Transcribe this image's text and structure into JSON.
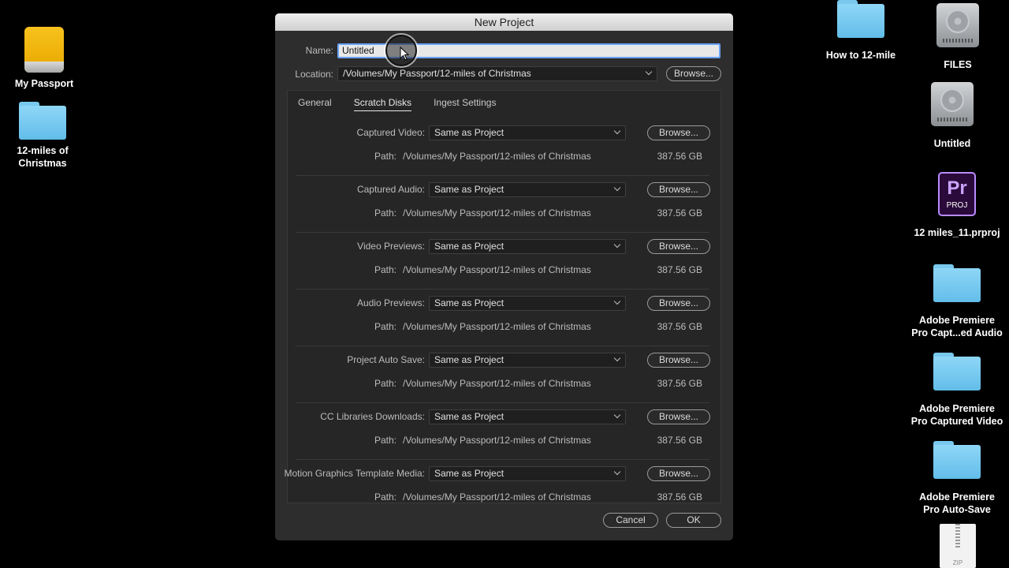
{
  "desktop": {
    "left_icons": [
      {
        "label": "My Passport",
        "icon": "external-drive-icon"
      },
      {
        "label": "12-miles of\nChristmas",
        "icon": "folder-icon"
      }
    ],
    "right_icons": [
      {
        "label": "How to 12-mile",
        "icon": "folder-icon"
      },
      {
        "label": "FILES",
        "icon": "hard-drive-icon"
      },
      {
        "label": "Untitled",
        "icon": "hard-drive-icon"
      },
      {
        "label": "12 miles_11.prproj",
        "icon": "premiere-project-icon",
        "badge": "Pr",
        "sub": "PROJ"
      },
      {
        "label": "Adobe Premiere\nPro Capt...ed Audio",
        "icon": "folder-icon"
      },
      {
        "label": "Adobe Premiere\nPro Captured Video",
        "icon": "folder-icon"
      },
      {
        "label": "Adobe Premiere\nPro Auto-Save",
        "icon": "folder-icon"
      },
      {
        "label": "ZIP",
        "icon": "zip-file-icon"
      }
    ]
  },
  "dialog": {
    "title": "New Project",
    "name_label": "Name:",
    "name_value": "Untitled",
    "location_label": "Location:",
    "location_value": "/Volumes/My Passport/12-miles of Christmas",
    "browse_label": "Browse...",
    "tabs": [
      {
        "label": "General",
        "active": false
      },
      {
        "label": "Scratch Disks",
        "active": true
      },
      {
        "label": "Ingest Settings",
        "active": false
      }
    ],
    "disks": [
      {
        "label": "Captured Video:",
        "value": "Same as Project",
        "path_label": "Path:",
        "path": "/Volumes/My Passport/12-miles of Christmas",
        "size": "387.56 GB",
        "browse": "Browse..."
      },
      {
        "label": "Captured Audio:",
        "value": "Same as Project",
        "path_label": "Path:",
        "path": "/Volumes/My Passport/12-miles of Christmas",
        "size": "387.56 GB",
        "browse": "Browse..."
      },
      {
        "label": "Video Previews:",
        "value": "Same as Project",
        "path_label": "Path:",
        "path": "/Volumes/My Passport/12-miles of Christmas",
        "size": "387.56 GB",
        "browse": "Browse..."
      },
      {
        "label": "Audio Previews:",
        "value": "Same as Project",
        "path_label": "Path:",
        "path": "/Volumes/My Passport/12-miles of Christmas",
        "size": "387.56 GB",
        "browse": "Browse..."
      },
      {
        "label": "Project Auto Save:",
        "value": "Same as Project",
        "path_label": "Path:",
        "path": "/Volumes/My Passport/12-miles of Christmas",
        "size": "387.56 GB",
        "browse": "Browse..."
      },
      {
        "label": "CC Libraries Downloads:",
        "value": "Same as Project",
        "path_label": "Path:",
        "path": "/Volumes/My Passport/12-miles of Christmas",
        "size": "387.56 GB",
        "browse": "Browse..."
      },
      {
        "label": "Motion Graphics Template Media:",
        "value": "Same as Project",
        "path_label": "Path:",
        "path": "/Volumes/My Passport/12-miles of Christmas",
        "size": "387.56 GB",
        "browse": "Browse..."
      }
    ],
    "cancel_label": "Cancel",
    "ok_label": "OK"
  }
}
